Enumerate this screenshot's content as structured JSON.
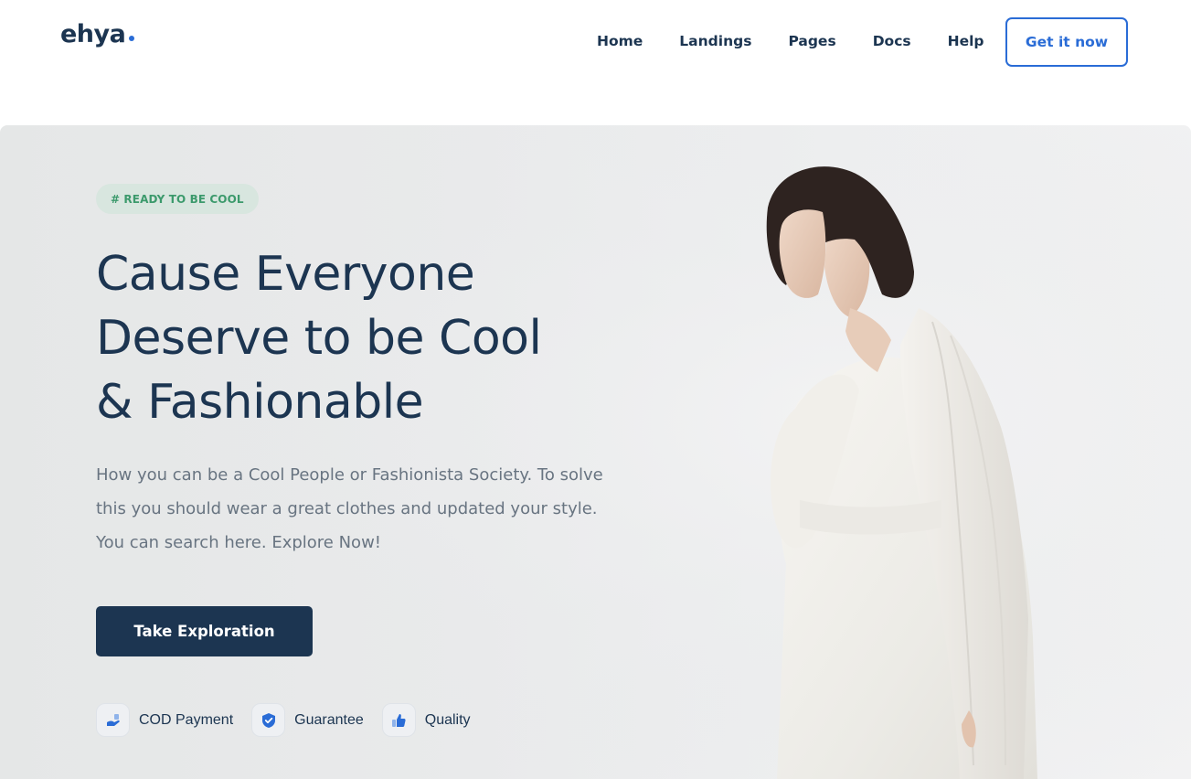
{
  "header": {
    "logo_text": "ehya",
    "nav": [
      {
        "label": "Home"
      },
      {
        "label": "Landings"
      },
      {
        "label": "Pages"
      },
      {
        "label": "Docs"
      },
      {
        "label": "Help"
      }
    ],
    "cta_label": "Get it now"
  },
  "hero": {
    "tag": "# READY TO BE COOL",
    "headline_lines": [
      "Cause Everyone",
      "Deserve to be Cool",
      "& Fashionable"
    ],
    "description": "How you can be a Cool People or Fashionista Society. To solve this you should wear a great clothes and updated your style. You can search here. Explore Now!",
    "primary_button": "Take Exploration",
    "features": [
      {
        "label": "COD Payment",
        "icon": "cash-hand-icon"
      },
      {
        "label": "Guarantee",
        "icon": "shield-check-icon"
      },
      {
        "label": "Quality",
        "icon": "thumbs-up-icon"
      }
    ],
    "image": "woman-in-white-outfit-photo"
  },
  "colors": {
    "brand_dark": "#1c3551",
    "accent_blue": "#2a6cd6",
    "tag_green": "#3c9a6c",
    "tag_bg": "#d8e6df",
    "body_text": "#687481"
  }
}
